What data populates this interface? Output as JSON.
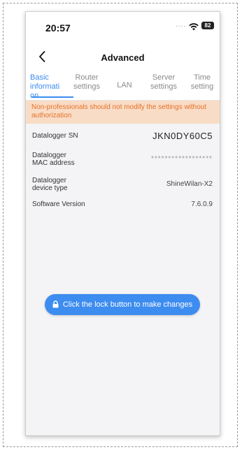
{
  "status": {
    "time": "20:57",
    "signal_dots": "....",
    "battery": "82"
  },
  "nav": {
    "title": "Advanced"
  },
  "tabs": [
    {
      "label": "Basic informati on",
      "active": true
    },
    {
      "label": "Router settings",
      "active": false
    },
    {
      "label": "LAN",
      "active": false
    },
    {
      "label": "Server settings",
      "active": false
    },
    {
      "label": "Time setting",
      "active": false
    }
  ],
  "warning": "Non-professionals should not modify the settings without authorization",
  "rows": [
    {
      "label": "Datalogger SN",
      "value": "JKN0DY60C5"
    },
    {
      "label": "Datalogger MAC address",
      "value": "******************"
    },
    {
      "label": "Datalogger device type",
      "value": "ShineWilan-X2"
    },
    {
      "label": "Software Version",
      "value": "7.6.0.9"
    }
  ],
  "lock_button": "Click the lock button to make changes",
  "colors": {
    "accent": "#3d8cf0",
    "warning_bg": "#f9dcc6",
    "warning_text": "#e5722a"
  }
}
